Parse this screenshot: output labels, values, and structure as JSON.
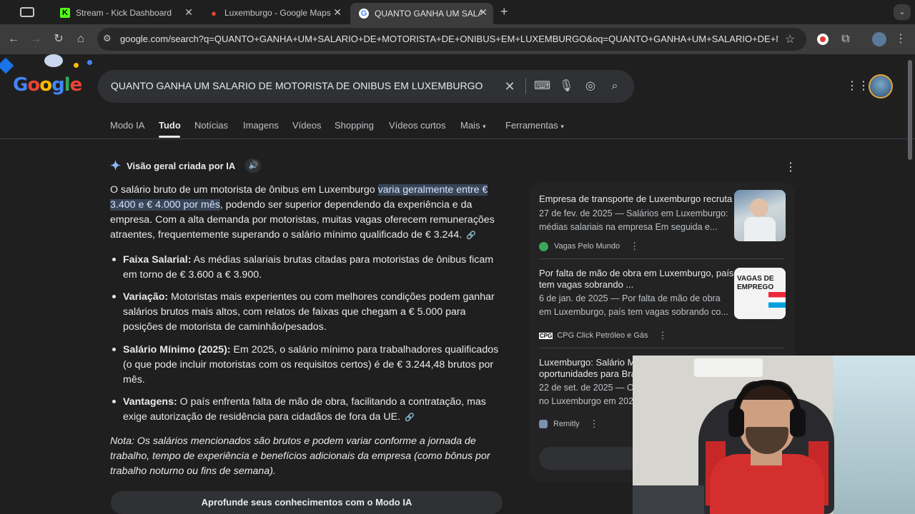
{
  "browser": {
    "tabs": [
      {
        "title": "Stream - Kick Dashboard",
        "favicon": "kick-icon"
      },
      {
        "title": "Luxemburgo - Google Maps",
        "favicon": "maps-pin-icon"
      },
      {
        "title": "QUANTO GANHA UM SALARI",
        "favicon": "google-g-icon"
      }
    ],
    "url": "google.com/search?q=QUANTO+GANHA+UM+SALARIO+DE+MOTORISTA+DE+ONIBUS+EM+LUXEMBURGO&oq=QUANTO+GANHA+UM+SALARIO+DE+MOTO..."
  },
  "search": {
    "logo": "Google",
    "query": "QUANTO GANHA UM SALARIO DE MOTORISTA DE ONIBUS EM LUXEMBURGO",
    "tabs": [
      "Modo IA",
      "Tudo",
      "Notícias",
      "Imagens",
      "Vídeos",
      "Shopping",
      "Vídeos curtos",
      "Mais",
      "Ferramentas"
    ],
    "active_tab": "Tudo"
  },
  "ai_overview": {
    "heading": "Visão geral criada por IA",
    "intro_pre": "O salário bruto de um motorista de ônibus em Luxemburgo ",
    "intro_hl1": "varia geralmente entre €",
    "intro_hl2": "3.400 e € 4.000 por mês",
    "intro_post1": ", podendo ser superior dependendo da experiência e da",
    "intro_post2": "empresa. Com a alta demanda por motoristas, muitas vagas oferecem remunerações",
    "intro_post3": "atraentes, frequentemente superando o salário mínimo qualificado de € 3.244.",
    "bullets": [
      {
        "label": "Faixa Salarial:",
        "lines": [
          " As médias salariais brutas citadas para motoristas de ônibus ficam",
          "em torno de € 3.600 a € 3.900."
        ]
      },
      {
        "label": "Variação:",
        "lines": [
          " Motoristas mais experientes ou com melhores condições podem ganhar",
          "salários brutos mais altos, com relatos de faixas que chegam a € 5.000 para",
          "posições de motorista de caminhão/pesados."
        ]
      },
      {
        "label": "Salário Mínimo (2025):",
        "lines": [
          " Em 2025, o salário mínimo para trabalhadores qualificados",
          "(o que pode incluir motoristas com os requisitos certos) é de € 3.244,48 brutos por",
          "mês."
        ]
      },
      {
        "label": "Vantagens:",
        "lines": [
          " O país enfrenta falta de mão de obra, facilitando a contratação, mas",
          "exige autorização de residência para cidadãos de fora da UE."
        ]
      }
    ],
    "note_lines": [
      "Nota: Os salários mencionados são brutos e podem variar conforme a jornada de",
      "trabalho, tempo de experiência e benefícios adicionais da empresa (como bônus por",
      "trabalho noturno ou fins de semana)."
    ],
    "deepen_button": "Aprofunde seus conhecimentos com o Modo IA"
  },
  "sources": [
    {
      "title_lines": [
        "Empresa de transporte de Luxemburgo recruta"
      ],
      "snippet_lines": [
        "27 de fev. de 2025 — Salários em Luxemburgo:",
        "médias salariais na empresa Em seguida e..."
      ],
      "site": "Vagas Pelo Mundo"
    },
    {
      "title_lines": [
        "Por falta de mão de obra em Luxemburgo, país",
        "tem vagas sobrando ..."
      ],
      "snippet_lines": [
        "6 de jan. de 2025 — Por falta de mão de obra",
        "em Luxemburgo, país tem vagas sobrando co..."
      ],
      "site": "CPG Click Petróleo e Gás",
      "thumb_text": "VAGAS DE EMPREGO"
    },
    {
      "title_lines": [
        "Luxemburgo: Salário Mí",
        "oportunidades para Bra"
      ],
      "snippet_lines": [
        "22 de set. de 2025 — O",
        "no Luxemburgo em 202"
      ],
      "site": "Remitly"
    }
  ],
  "colors": {
    "accent_highlight": "#394457",
    "background": "#1f1f1f"
  }
}
